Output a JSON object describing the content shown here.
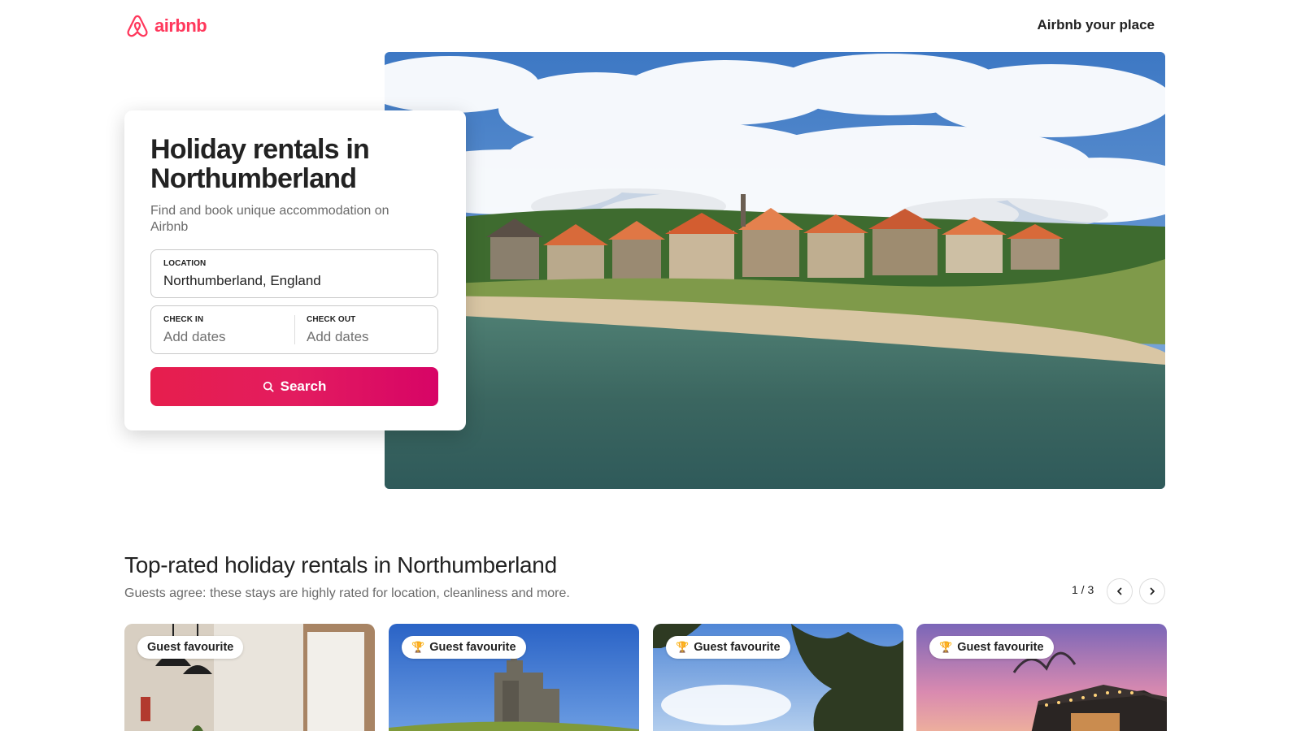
{
  "header": {
    "logo_text": "airbnb",
    "host_link": "Airbnb your place",
    "brand_color": "#ff385c"
  },
  "hero_card": {
    "title": "Holiday rentals in Northumberland",
    "subtitle": "Find and book unique accommodation on Airbnb",
    "location": {
      "label": "LOCATION",
      "value": "Northumberland, England"
    },
    "check_in": {
      "label": "CHECK IN",
      "placeholder": "Add dates"
    },
    "check_out": {
      "label": "CHECK OUT",
      "placeholder": "Add dates"
    },
    "search_label": "Search"
  },
  "section": {
    "title": "Top-rated holiday rentals in Northumberland",
    "subtitle": "Guests agree: these stays are highly rated for location, cleanliness and more.",
    "pager": "1 / 3"
  },
  "listings": [
    {
      "badge": "Guest favourite",
      "trophy_icon": false
    },
    {
      "badge": "Guest favourite",
      "trophy_icon": true
    },
    {
      "badge": "Guest favourite",
      "trophy_icon": true
    },
    {
      "badge": "Guest favourite",
      "trophy_icon": true
    }
  ]
}
